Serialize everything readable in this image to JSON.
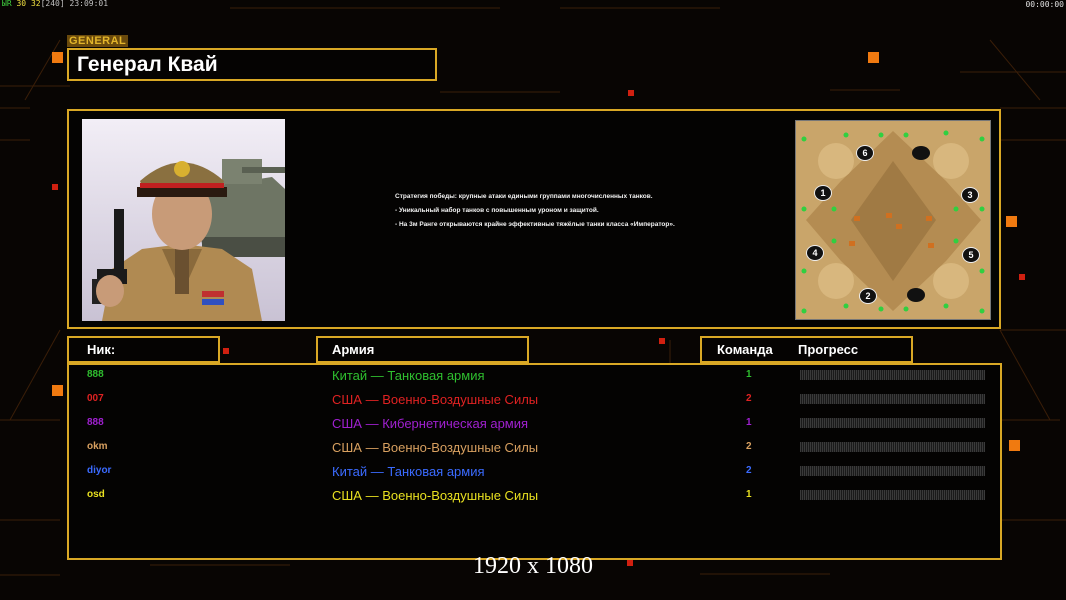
{
  "hud": {
    "stats_a": "ЫR",
    "stats_b": "30",
    "stats_c": "32",
    "stats_d": "[240]",
    "time": "23:09:01",
    "clock": "00:00:00"
  },
  "general": {
    "tag": "GENERAL",
    "name": "Генерал Квай"
  },
  "strategy": {
    "lines": [
      "Стратегия победы: крупные атаки едиными группами многочисленных танков.",
      "- Уникальный набор танков с повышенным уроном и защитой.",
      "- На 3м Ранге открываются крайне эффективные тяжёлые танки класса «Император»."
    ]
  },
  "minimap": {
    "spawns": [
      "1",
      "2",
      "3",
      "4",
      "5",
      "6"
    ]
  },
  "headers": {
    "nick": "Ник:",
    "army": "Армия",
    "team": "Команда",
    "progress": "Прогресс"
  },
  "players": [
    {
      "nick": "888",
      "army": "Китай — Танковая армия",
      "team": "1",
      "color": "#2fbf2f"
    },
    {
      "nick": "007",
      "army": "США — Военно-Воздушные Силы",
      "team": "2",
      "color": "#e02222"
    },
    {
      "nick": "888",
      "army": "США — Кибернетическая армия",
      "team": "1",
      "color": "#a020d0"
    },
    {
      "nick": "okm",
      "army": "США — Военно-Воздушные Силы",
      "team": "2",
      "color": "#d8a060"
    },
    {
      "nick": "diyor",
      "army": "Китай — Танковая армия",
      "team": "2",
      "color": "#3b6bff"
    },
    {
      "nick": "osd",
      "army": "США — Военно-Воздушные Силы",
      "team": "1",
      "color": "#e8e020"
    }
  ],
  "footer": {
    "resolution": "1920 x 1080"
  },
  "colors": {
    "accent": "#d9a825",
    "orange": "#f07a10",
    "background": "#080503"
  }
}
